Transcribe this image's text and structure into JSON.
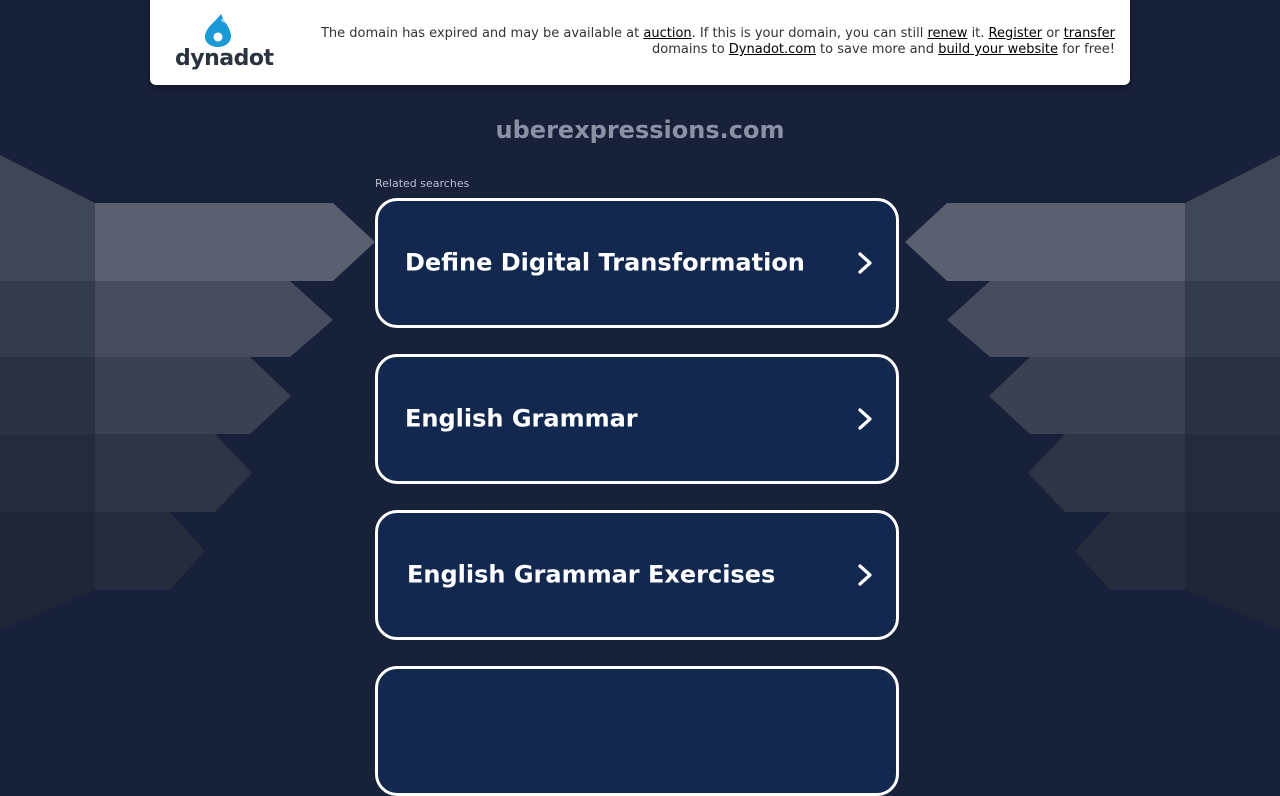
{
  "brand": {
    "logo_text": "dynadot"
  },
  "notice": {
    "line1_prefix": "The domain has expired and may be available at ",
    "auction_link": "auction",
    "line1_mid": ". If this is your domain, you can still ",
    "renew_link": "renew",
    "line1_mid2": " it. ",
    "register_link": "Register",
    "line1_or": " or ",
    "transfer_link": "transfer",
    "line2_prefix": "domains to ",
    "dynadot_link": "Dynadot.com",
    "line2_mid": " to save more and ",
    "build_link": "build your website",
    "line2_suffix": " for free!"
  },
  "domain": "uberexpressions.com",
  "related_label": "Related searches",
  "searches": [
    {
      "label": "Define Digital Transformation"
    },
    {
      "label": "English Grammar"
    },
    {
      "label": "English Grammar Exercises"
    },
    {
      "label": ""
    }
  ],
  "colors": {
    "background": "#17213a",
    "card": "#13284f",
    "logo_accent": "#1a9ad6"
  }
}
